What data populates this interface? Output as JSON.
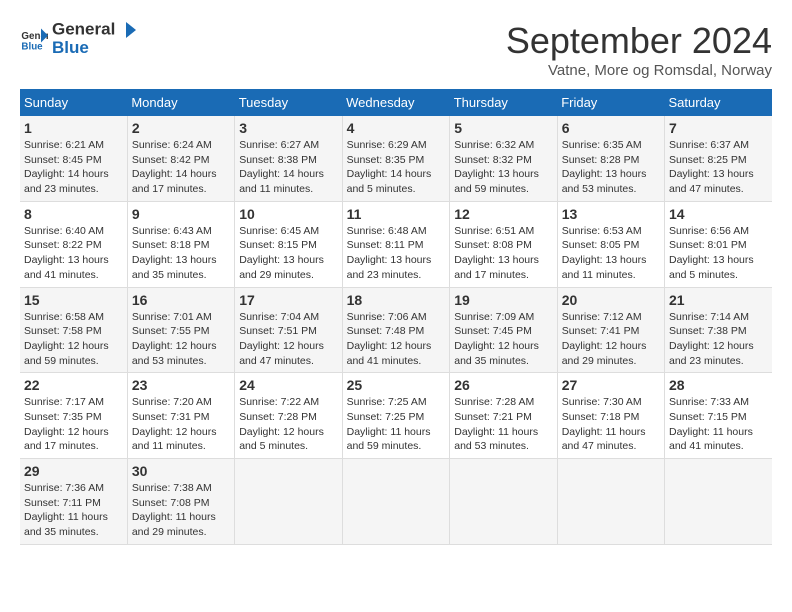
{
  "header": {
    "logo_general": "General",
    "logo_blue": "Blue",
    "month_title": "September 2024",
    "subtitle": "Vatne, More og Romsdal, Norway"
  },
  "weekdays": [
    "Sunday",
    "Monday",
    "Tuesday",
    "Wednesday",
    "Thursday",
    "Friday",
    "Saturday"
  ],
  "weeks": [
    [
      {
        "day": "1",
        "info": "Sunrise: 6:21 AM\nSunset: 8:45 PM\nDaylight: 14 hours and 23 minutes."
      },
      {
        "day": "2",
        "info": "Sunrise: 6:24 AM\nSunset: 8:42 PM\nDaylight: 14 hours and 17 minutes."
      },
      {
        "day": "3",
        "info": "Sunrise: 6:27 AM\nSunset: 8:38 PM\nDaylight: 14 hours and 11 minutes."
      },
      {
        "day": "4",
        "info": "Sunrise: 6:29 AM\nSunset: 8:35 PM\nDaylight: 14 hours and 5 minutes."
      },
      {
        "day": "5",
        "info": "Sunrise: 6:32 AM\nSunset: 8:32 PM\nDaylight: 13 hours and 59 minutes."
      },
      {
        "day": "6",
        "info": "Sunrise: 6:35 AM\nSunset: 8:28 PM\nDaylight: 13 hours and 53 minutes."
      },
      {
        "day": "7",
        "info": "Sunrise: 6:37 AM\nSunset: 8:25 PM\nDaylight: 13 hours and 47 minutes."
      }
    ],
    [
      {
        "day": "8",
        "info": "Sunrise: 6:40 AM\nSunset: 8:22 PM\nDaylight: 13 hours and 41 minutes."
      },
      {
        "day": "9",
        "info": "Sunrise: 6:43 AM\nSunset: 8:18 PM\nDaylight: 13 hours and 35 minutes."
      },
      {
        "day": "10",
        "info": "Sunrise: 6:45 AM\nSunset: 8:15 PM\nDaylight: 13 hours and 29 minutes."
      },
      {
        "day": "11",
        "info": "Sunrise: 6:48 AM\nSunset: 8:11 PM\nDaylight: 13 hours and 23 minutes."
      },
      {
        "day": "12",
        "info": "Sunrise: 6:51 AM\nSunset: 8:08 PM\nDaylight: 13 hours and 17 minutes."
      },
      {
        "day": "13",
        "info": "Sunrise: 6:53 AM\nSunset: 8:05 PM\nDaylight: 13 hours and 11 minutes."
      },
      {
        "day": "14",
        "info": "Sunrise: 6:56 AM\nSunset: 8:01 PM\nDaylight: 13 hours and 5 minutes."
      }
    ],
    [
      {
        "day": "15",
        "info": "Sunrise: 6:58 AM\nSunset: 7:58 PM\nDaylight: 12 hours and 59 minutes."
      },
      {
        "day": "16",
        "info": "Sunrise: 7:01 AM\nSunset: 7:55 PM\nDaylight: 12 hours and 53 minutes."
      },
      {
        "day": "17",
        "info": "Sunrise: 7:04 AM\nSunset: 7:51 PM\nDaylight: 12 hours and 47 minutes."
      },
      {
        "day": "18",
        "info": "Sunrise: 7:06 AM\nSunset: 7:48 PM\nDaylight: 12 hours and 41 minutes."
      },
      {
        "day": "19",
        "info": "Sunrise: 7:09 AM\nSunset: 7:45 PM\nDaylight: 12 hours and 35 minutes."
      },
      {
        "day": "20",
        "info": "Sunrise: 7:12 AM\nSunset: 7:41 PM\nDaylight: 12 hours and 29 minutes."
      },
      {
        "day": "21",
        "info": "Sunrise: 7:14 AM\nSunset: 7:38 PM\nDaylight: 12 hours and 23 minutes."
      }
    ],
    [
      {
        "day": "22",
        "info": "Sunrise: 7:17 AM\nSunset: 7:35 PM\nDaylight: 12 hours and 17 minutes."
      },
      {
        "day": "23",
        "info": "Sunrise: 7:20 AM\nSunset: 7:31 PM\nDaylight: 12 hours and 11 minutes."
      },
      {
        "day": "24",
        "info": "Sunrise: 7:22 AM\nSunset: 7:28 PM\nDaylight: 12 hours and 5 minutes."
      },
      {
        "day": "25",
        "info": "Sunrise: 7:25 AM\nSunset: 7:25 PM\nDaylight: 11 hours and 59 minutes."
      },
      {
        "day": "26",
        "info": "Sunrise: 7:28 AM\nSunset: 7:21 PM\nDaylight: 11 hours and 53 minutes."
      },
      {
        "day": "27",
        "info": "Sunrise: 7:30 AM\nSunset: 7:18 PM\nDaylight: 11 hours and 47 minutes."
      },
      {
        "day": "28",
        "info": "Sunrise: 7:33 AM\nSunset: 7:15 PM\nDaylight: 11 hours and 41 minutes."
      }
    ],
    [
      {
        "day": "29",
        "info": "Sunrise: 7:36 AM\nSunset: 7:11 PM\nDaylight: 11 hours and 35 minutes."
      },
      {
        "day": "30",
        "info": "Sunrise: 7:38 AM\nSunset: 7:08 PM\nDaylight: 11 hours and 29 minutes."
      },
      {
        "day": "",
        "info": ""
      },
      {
        "day": "",
        "info": ""
      },
      {
        "day": "",
        "info": ""
      },
      {
        "day": "",
        "info": ""
      },
      {
        "day": "",
        "info": ""
      }
    ]
  ]
}
